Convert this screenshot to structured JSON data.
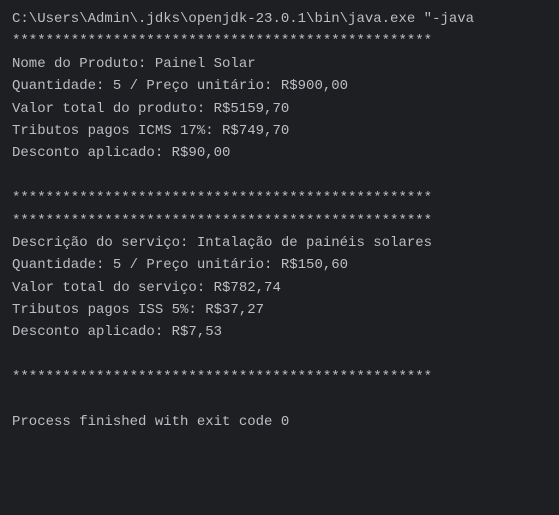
{
  "console": {
    "command": "C:\\Users\\Admin\\.jdks\\openjdk-23.0.1\\bin\\java.exe \"-java",
    "separator": "**************************************************",
    "product": {
      "name_label": "Nome do Produto: Painel Solar",
      "quantity_price": "Quantidade: 5 / Preço unitário: R$900,00",
      "total": "Valor total do produto: R$5159,70",
      "taxes": "Tributos pagos ICMS 17%: R$749,70",
      "discount": "Desconto aplicado: R$90,00"
    },
    "service": {
      "description": "Descrição do serviço: Intalação de painéis solares",
      "quantity_price": "Quantidade: 5 / Preço unitário: R$150,60",
      "total": "Valor total do serviço: R$782,74",
      "taxes": "Tributos pagos ISS 5%: R$37,27",
      "discount": "Desconto aplicado: R$7,53"
    },
    "exit_message": "Process finished with exit code 0"
  }
}
